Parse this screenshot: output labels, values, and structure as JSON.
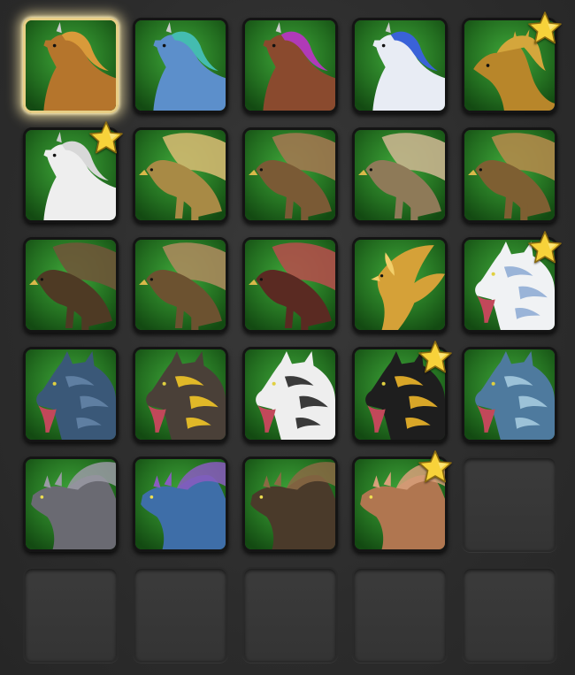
{
  "colors": {
    "background": "#2f2f2f",
    "slot_green_light": "#3fa83a",
    "slot_green_dark": "#134a12",
    "selection_glow": "#f5e3a5",
    "star_gold": "#f7d23a"
  },
  "mounts": [
    {
      "kind": "horse",
      "body": "#b5752c",
      "mane": "#d99a3a",
      "selected": true,
      "favorite": false
    },
    {
      "kind": "horse",
      "body": "#5c8fcb",
      "mane": "#44bcb0",
      "selected": false,
      "favorite": false
    },
    {
      "kind": "horse",
      "body": "#8a4a2e",
      "mane": "#b03ab8",
      "selected": false,
      "favorite": false
    },
    {
      "kind": "horse",
      "body": "#e8ecf4",
      "mane": "#3a62d8",
      "selected": false,
      "favorite": false
    },
    {
      "kind": "dragon-horse",
      "body": "#b8862a",
      "mane": "#d4a63c",
      "selected": false,
      "favorite": true
    },
    {
      "kind": "horse",
      "body": "#eeeeee",
      "mane": "#d8d8d8",
      "selected": false,
      "favorite": true
    },
    {
      "kind": "griffin",
      "body": "#a88a45",
      "mane": "#d2b870",
      "selected": false,
      "favorite": false
    },
    {
      "kind": "griffin",
      "body": "#7a5a35",
      "mane": "#a07850",
      "selected": false,
      "favorite": false
    },
    {
      "kind": "griffin",
      "body": "#8e7a58",
      "mane": "#c8b48e",
      "selected": false,
      "favorite": false
    },
    {
      "kind": "griffin",
      "body": "#7e5f32",
      "mane": "#b08a4a",
      "selected": false,
      "favorite": false
    },
    {
      "kind": "griffin",
      "body": "#4e3a24",
      "mane": "#6e5638",
      "selected": false,
      "favorite": false
    },
    {
      "kind": "griffin",
      "body": "#6c5230",
      "mane": "#a88a5c",
      "selected": false,
      "favorite": false
    },
    {
      "kind": "griffin",
      "body": "#5a2a22",
      "mane": "#b0504a",
      "selected": false,
      "favorite": false
    },
    {
      "kind": "phoenix",
      "body": "#d5a138",
      "mane": "#f2cf6a",
      "selected": false,
      "favorite": false
    },
    {
      "kind": "wolf",
      "body": "#f0f2f4",
      "mane": "#9ab4d8",
      "selected": false,
      "favorite": true
    },
    {
      "kind": "wolf",
      "body": "#3a5878",
      "mane": "#5f7fa2",
      "selected": false,
      "favorite": false
    },
    {
      "kind": "wolf",
      "body": "#4a4038",
      "mane": "#e0b828",
      "selected": false,
      "favorite": false
    },
    {
      "kind": "wolf",
      "body": "#eeeeee",
      "mane": "#3a3a3a",
      "selected": false,
      "favorite": false
    },
    {
      "kind": "wolf",
      "body": "#1e1e1e",
      "mane": "#d8a628",
      "selected": false,
      "favorite": true
    },
    {
      "kind": "wolf",
      "body": "#4e7a9e",
      "mane": "#9cc2d8",
      "selected": false,
      "favorite": false
    },
    {
      "kind": "dragon",
      "body": "#6a6a72",
      "mane": "#9a9aa4",
      "selected": false,
      "favorite": false
    },
    {
      "kind": "dragon",
      "body": "#3e6ea8",
      "mane": "#8a5cc0",
      "selected": false,
      "favorite": false
    },
    {
      "kind": "dragon",
      "body": "#4a3a2a",
      "mane": "#8a6a44",
      "selected": false,
      "favorite": false
    },
    {
      "kind": "dragon",
      "body": "#b07650",
      "mane": "#d8a07a",
      "selected": false,
      "favorite": true
    }
  ],
  "empty_slots": 6
}
